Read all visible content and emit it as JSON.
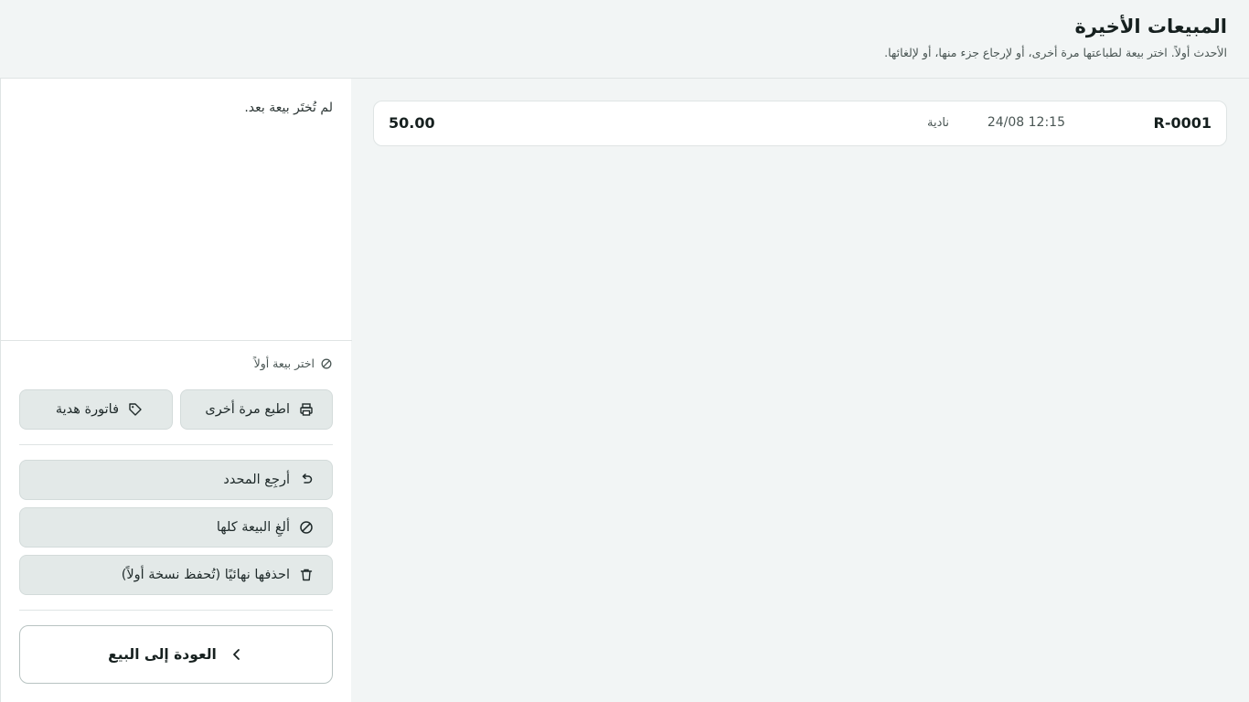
{
  "header": {
    "title": "المبيعات الأخيرة",
    "subtitle": "الأحدث أولاً. اختر بيعة لطباعتها مرة أخرى، أو لإرجاع جزء منها، أو لإلغائها."
  },
  "sales": [
    {
      "id": "R-0001",
      "time": "24/08 12:15",
      "customer": "نادية",
      "amount": "50.00"
    }
  ],
  "panel": {
    "empty_text": "لم تُختَر بيعة بعد.",
    "hint": "اختر بيعة أولاً",
    "hint_icon": "ban-icon",
    "buttons": {
      "print": "اطبع مرة أخرى",
      "gift": "فاتورة هدية",
      "return": "أرجِع المحدد",
      "void": "ألغِ البيعة كلها",
      "delete": "احذفها نهائيًا (تُحفظ نسخة أولاً)",
      "back": "العودة إلى البيع"
    }
  },
  "colors": {
    "background": "#f2f5f5",
    "panel": "#ffffff",
    "button": "#e3e9e8",
    "text": "#1f2a2a"
  }
}
